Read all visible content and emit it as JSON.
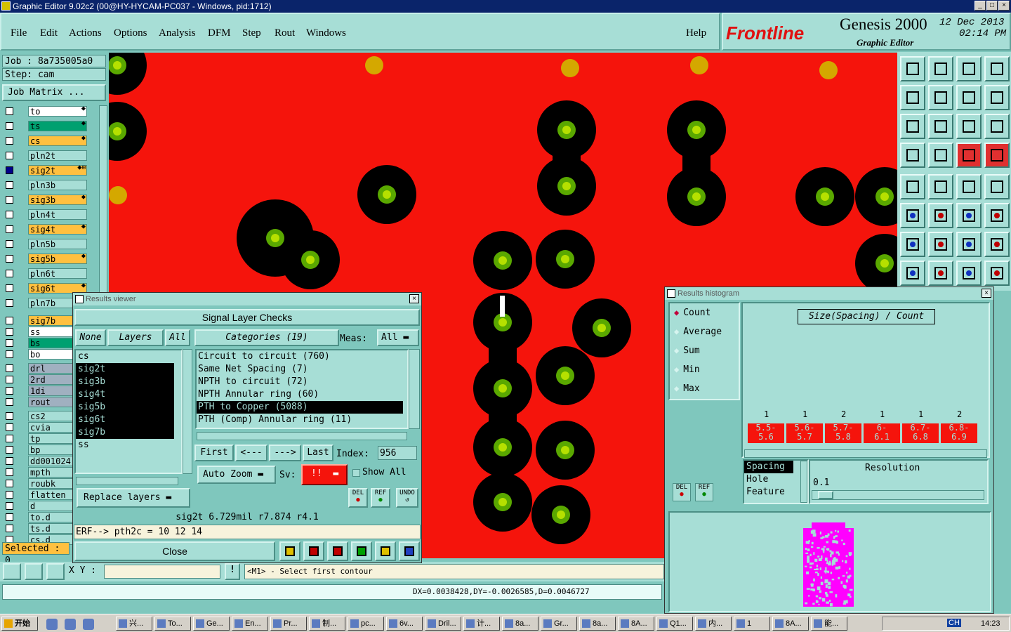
{
  "window": {
    "title": "Graphic Editor 9.02c2 (00@HY-HYCAM-PC037 - Windows, pid:1712)",
    "min_label": "_",
    "max_label": "□",
    "close_label": "×"
  },
  "menu": [
    "File",
    "Edit",
    "Actions",
    "Options",
    "Analysis",
    "DFM",
    "Step",
    "Rout",
    "Windows"
  ],
  "help_label": "Help",
  "brand": {
    "logo": "Frontline",
    "product": "Genesis 2000",
    "subtitle": "Graphic Editor",
    "date": "12 Dec 2013",
    "time": "02:14 PM"
  },
  "job": {
    "job_label": "Job : 8a735005a0",
    "step_label": "Step: cam",
    "matrix_button": "Job Matrix ..."
  },
  "layers": [
    {
      "name": "to",
      "color": "#ffffff",
      "flag": "⬥"
    },
    {
      "name": "ts",
      "color": "#00a070",
      "flag": "⬥"
    },
    {
      "name": "cs",
      "color": "#ffc040",
      "flag": "⬥"
    },
    {
      "name": "pln2t",
      "color": "#a7ded6",
      "flag": ""
    },
    {
      "name": "sig2t",
      "color": "#ffc040",
      "flag": "⬥⊞",
      "active": true
    },
    {
      "name": "pln3b",
      "color": "#a7ded6",
      "flag": ""
    },
    {
      "name": "sig3b",
      "color": "#ffc040",
      "flag": "⬥"
    },
    {
      "name": "pln4t",
      "color": "#a7ded6",
      "flag": ""
    },
    {
      "name": "sig4t",
      "color": "#ffc040",
      "flag": "⬥"
    },
    {
      "name": "pln5b",
      "color": "#a7ded6",
      "flag": ""
    },
    {
      "name": "sig5b",
      "color": "#ffc040",
      "flag": "⬥"
    },
    {
      "name": "pln6t",
      "color": "#a7ded6",
      "flag": ""
    },
    {
      "name": "sig6t",
      "color": "#ffc040",
      "flag": "⬥"
    },
    {
      "name": "pln7b",
      "color": "#a7ded6",
      "flag": ""
    },
    {
      "name": "sig7b",
      "color": "#ffc040",
      "flag": ""
    },
    {
      "name": "ss",
      "color": "#ffffff",
      "flag": ""
    },
    {
      "name": "bs",
      "color": "#00a070",
      "flag": ""
    },
    {
      "name": "bo",
      "color": "#ffffff",
      "flag": ""
    },
    {
      "name": "drl",
      "color": "#a0b0c0",
      "flag": ""
    },
    {
      "name": "2rd",
      "color": "#a0b0c0",
      "flag": ""
    },
    {
      "name": "1di",
      "color": "#a0b0c0",
      "flag": ""
    },
    {
      "name": "rout",
      "color": "#a0b0c0",
      "flag": ""
    },
    {
      "name": "cs2",
      "color": "#a7ded6",
      "flag": ""
    },
    {
      "name": "cvia",
      "color": "#a7ded6",
      "flag": ""
    },
    {
      "name": "tp",
      "color": "#a7ded6",
      "flag": ""
    },
    {
      "name": "bp",
      "color": "#a7ded6",
      "flag": ""
    },
    {
      "name": "dd001024",
      "color": "#a7ded6",
      "flag": ""
    },
    {
      "name": "mpth",
      "color": "#a7ded6",
      "flag": ""
    },
    {
      "name": "roubk",
      "color": "#a7ded6",
      "flag": ""
    },
    {
      "name": "flatten",
      "color": "#a7ded6",
      "flag": ""
    },
    {
      "name": "d",
      "color": "#a7ded6",
      "flag": ""
    },
    {
      "name": "to.d",
      "color": "#a7ded6",
      "flag": ""
    },
    {
      "name": "ts.d",
      "color": "#a7ded6",
      "flag": ""
    },
    {
      "name": "cs.d",
      "color": "#a7ded6",
      "flag": ""
    }
  ],
  "selected_label": "Selected : 0",
  "xy_label": "X Y :",
  "excl_label": "!",
  "prompt": "<M1> - Select first contour",
  "status_readout": "DX=0.0038428,DY=-0.0026585,D=0.0046727",
  "results_viewer": {
    "title": "Results viewer",
    "close_x": "×",
    "header": "Signal Layer Checks",
    "none_btn": "None",
    "layers_btn": "Layers",
    "all_btn": "All",
    "categories_btn": "Categories (19)",
    "meas_label": "Meas:",
    "meas_value": "All",
    "layer_list": [
      {
        "name": "cs",
        "sel": false
      },
      {
        "name": "sig2t",
        "sel": true
      },
      {
        "name": "sig3b",
        "sel": true
      },
      {
        "name": "sig4t",
        "sel": true
      },
      {
        "name": "sig5b",
        "sel": true
      },
      {
        "name": "sig6t",
        "sel": true
      },
      {
        "name": "sig7b",
        "sel": true
      },
      {
        "name": "ss",
        "sel": false
      }
    ],
    "categories": [
      {
        "name": "Circuit to circuit (760)",
        "sel": false
      },
      {
        "name": "Same Net Spacing (7)",
        "sel": false
      },
      {
        "name": "NPTH to circuit (72)",
        "sel": false
      },
      {
        "name": "NPTH Annular ring (60)",
        "sel": false
      },
      {
        "name": "PTH to Copper (5088)",
        "sel": true
      },
      {
        "name": "PTH (Comp) Annular ring (11)",
        "sel": false
      }
    ],
    "first_btn": "First",
    "prev_btn": "<---",
    "next_btn": "--->",
    "last_btn": "Last",
    "index_label": "Index:",
    "index_value": "956",
    "autozoom_btn": "Auto Zoom",
    "sv_label": "Sv:",
    "sv_value": "!!",
    "show_all": "Show All",
    "replace_btn": "Replace layers",
    "del_btn": "DEL",
    "ref_btn": "REF",
    "undo_btn": "UNDO",
    "info_line": "sig2t 6.729mil   r7.874  r4.1",
    "erf_line": "ERF--> pth2c = 10 12 14",
    "close_btn": "Close"
  },
  "histogram": {
    "title": "Results histogram",
    "close_x": "×",
    "modes": [
      "Count",
      "Average",
      "Sum",
      "Min",
      "Max"
    ],
    "chart_title": "Size(Spacing) / Count",
    "counts": [
      "1",
      "1",
      "2",
      "1",
      "1",
      "2"
    ],
    "bins": [
      [
        "5.5-",
        "5.6"
      ],
      [
        "5.6-",
        "5.7"
      ],
      [
        "5.7-",
        "5.8"
      ],
      [
        "6-",
        "6.1"
      ],
      [
        "6.7-",
        "6.8"
      ],
      [
        "6.8-",
        "6.9"
      ]
    ],
    "types": [
      "Spacing",
      "Hole",
      "Feature"
    ],
    "resolution_label": "Resolution",
    "resolution_value": "0.1",
    "del_btn": "DEL",
    "ref_btn": "REF"
  },
  "taskbar": {
    "start": "开始",
    "tasks": [
      "兴...",
      "To...",
      "Ge...",
      "En...",
      "Pr...",
      "制...",
      "pc...",
      "6v...",
      "Dril...",
      "计...",
      "8a...",
      "Gr...",
      "8a...",
      "8A...",
      "Q1...",
      "内...",
      "1",
      "8A...",
      "能..."
    ],
    "clock": "14:23",
    "tray_lang": "CH"
  },
  "colors": {
    "panel": "#7fc7bd",
    "button": "#a7ded6",
    "copper": "#f5140c",
    "pad": "#000000",
    "drill": "#5aa800",
    "fiducial": "#d4a800"
  }
}
